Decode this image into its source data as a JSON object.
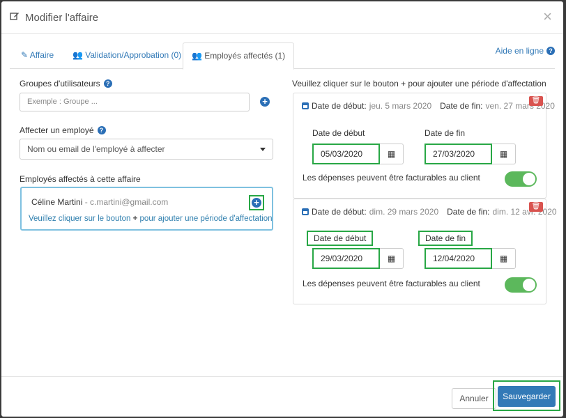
{
  "modal": {
    "title": "Modifier l'affaire",
    "close_glyph": "×"
  },
  "tabs": [
    {
      "label": "Affaire",
      "icon": "pencil-icon"
    },
    {
      "label": "Validation/Approbation (0)",
      "icon": "users-icon"
    },
    {
      "label": "Employés affectés (1)",
      "icon": "users-icon"
    }
  ],
  "help": {
    "label": "Aide en ligne"
  },
  "left": {
    "groups_label": "Groupes d'utilisateurs",
    "groups_placeholder": "Exemple : Groupe ...",
    "assign_label": "Affecter un employé",
    "assign_select_value": "Nom ou email de l'employé à affecter",
    "assigned_label": "Employés affectés à cette affaire",
    "employee_name": "Céline Martini",
    "employee_sep": " - ",
    "employee_email": "c.martini@gmail.com",
    "employee_hint_before": "Veuillez cliquer sur le bouton",
    "employee_hint_plus": "+",
    "employee_hint_after": "pour ajouter une période d'affectation"
  },
  "right": {
    "intro": "Veuillez cliquer sur le bouton + pour ajouter une période d'affectation",
    "periods": [
      {
        "start_caption": "Date de début:",
        "start_text": "jeu. 5 mars 2020",
        "end_caption": "Date de fin:",
        "end_text": "ven. 27 mars 2020",
        "start_label": "Date de début",
        "end_label": "Date de fin",
        "start_value": "05/03/2020",
        "end_value": "27/03/2020",
        "billable_label": "Les dépenses peuvent être facturables au client",
        "billable": true
      },
      {
        "start_caption": "Date de début:",
        "start_text": "dim. 29 mars 2020",
        "end_caption": "Date de fin:",
        "end_text": "dim. 12 avr. 2020",
        "start_label": "Date de début",
        "end_label": "Date de fin",
        "start_value": "29/03/2020",
        "end_value": "12/04/2020",
        "billable_label": "Les dépenses peuvent être facturables au client",
        "billable": true
      }
    ]
  },
  "footer": {
    "cancel_label": "Annuler",
    "save_label": "Sauvegarder"
  },
  "colors": {
    "primary": "#337ab7",
    "success": "#5cb85c",
    "danger": "#d9534f",
    "highlight": "#28a745"
  }
}
